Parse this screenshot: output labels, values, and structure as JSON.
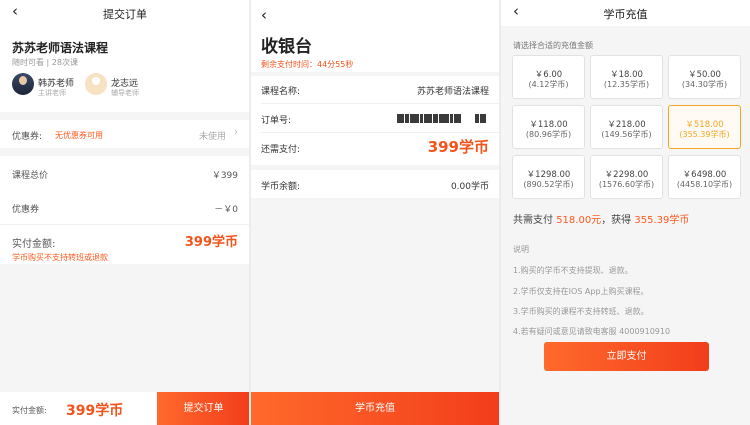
{
  "order": {
    "nav_title": "提交订单",
    "course_title": "苏苏老师语法课程",
    "course_meta": "随时可看 | 28次课",
    "teachers": [
      {
        "name": "韩苏老师",
        "role": "主讲老师"
      },
      {
        "name": "龙志远",
        "role": "辅导老师"
      }
    ],
    "coupon_label": "优惠券:",
    "coupon_tip": "无优惠券可用",
    "coupon_status": "未使用",
    "total_label": "课程总价",
    "total_value": "￥399",
    "discount_label": "优惠券",
    "discount_value": "－￥0",
    "actual_label": "实付金额:",
    "actual_value": "399学币",
    "warning": "学币购买不支持转班或退款",
    "bottom_label": "实付金额:",
    "bottom_amount": "399学币",
    "submit_label": "提交订单"
  },
  "cashier": {
    "title": "收银台",
    "countdown": "剩余支付时间：44分55秒",
    "course_label": "课程名称:",
    "course_value": "苏苏老师语法课程",
    "order_label": "订单号:",
    "due_label": "还需支付:",
    "due_value": "399学币",
    "balance_label": "学币余额:",
    "balance_value": "0.00学币",
    "recharge_label": "学币充值"
  },
  "recharge": {
    "nav_title": "学币充值",
    "hint": "请选择合适的充值金额",
    "options": [
      {
        "price": "￥6.00",
        "coins": "(4.12学币)"
      },
      {
        "price": "￥18.00",
        "coins": "(12.35学币)"
      },
      {
        "price": "￥50.00",
        "coins": "(34.30学币)"
      },
      {
        "price": "￥118.00",
        "coins": "(80.96学币)"
      },
      {
        "price": "￥218.00",
        "coins": "(149.56学币)"
      },
      {
        "price": "￥518.00",
        "coins": "(355.39学币)"
      },
      {
        "price": "￥1298.00",
        "coins": "(890.52学币)"
      },
      {
        "price": "￥2298.00",
        "coins": "(1576.60学币)"
      },
      {
        "price": "￥6498.00",
        "coins": "(4458.10学币)"
      }
    ],
    "selected_index": 5,
    "summary_prefix": "共需支付",
    "summary_amount": "518.00元",
    "summary_mid": "，获得",
    "summary_coins": "355.39学币",
    "notes_title": "说明",
    "notes": [
      "1.购买的学币不支持提现、退款。",
      "2.学币仅支持在IOS App上购买课程。",
      "3.学币购买的课程不支持转班、退款。",
      "4.若有疑问或意见请致电客服 4000910910"
    ],
    "pay_label": "立即支付"
  },
  "colors": {
    "accent": "#f2541b",
    "selected": "#f5a623"
  },
  "icons": {
    "back": "chevron-left-icon",
    "arrow": "chevron-right-icon"
  }
}
